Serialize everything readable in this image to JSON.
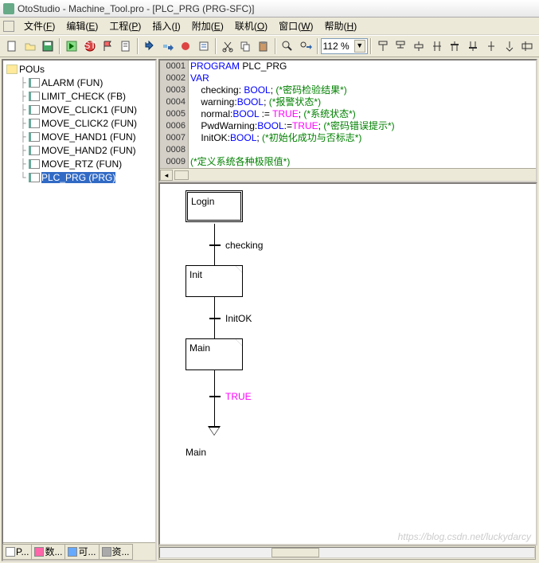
{
  "title": "OtoStudio - Machine_Tool.pro - [PLC_PRG (PRG-SFC)]",
  "menu": {
    "file": "文件",
    "file_k": "F",
    "edit": "编辑",
    "edit_k": "E",
    "project": "工程",
    "project_k": "P",
    "insert": "插入",
    "insert_k": "I",
    "extras": "附加",
    "extras_k": "E",
    "online": "联机",
    "online_k": "O",
    "window": "窗口",
    "window_k": "W",
    "help": "帮助",
    "help_k": "H"
  },
  "toolbar": {
    "zoom": "112 %"
  },
  "tree": {
    "root": "POUs",
    "items": [
      {
        "label": "ALARM (FUN)",
        "selected": false
      },
      {
        "label": "LIMIT_CHECK (FB)",
        "selected": false
      },
      {
        "label": "MOVE_CLICK1 (FUN)",
        "selected": false
      },
      {
        "label": "MOVE_CLICK2 (FUN)",
        "selected": false
      },
      {
        "label": "MOVE_HAND1 (FUN)",
        "selected": false
      },
      {
        "label": "MOVE_HAND2 (FUN)",
        "selected": false
      },
      {
        "label": "MOVE_RTZ (FUN)",
        "selected": false
      },
      {
        "label": "PLC_PRG (PRG)",
        "selected": true
      }
    ]
  },
  "sidebar_tabs": [
    "P...",
    "数...",
    "可...",
    "资..."
  ],
  "code": {
    "lines": [
      {
        "n": "0001",
        "html": "<span class='kw'>PROGRAM</span> PLC_PRG"
      },
      {
        "n": "0002",
        "html": "<span class='kw'>VAR</span>"
      },
      {
        "n": "0003",
        "html": "    checking: <span class='kw'>BOOL</span>; <span class='cm'>(*密码检验结果*)</span>"
      },
      {
        "n": "0004",
        "html": "    warning:<span class='kw'>BOOL</span>; <span class='cm'>(*报警状态*)</span>"
      },
      {
        "n": "0005",
        "html": "    normal:<span class='kw'>BOOL</span> := <span class='hl'>TRUE</span>; <span class='cm'>(*系统状态*)</span>"
      },
      {
        "n": "0006",
        "html": "    PwdWarning:<span class='kw'>BOOL</span>:=<span class='hl'>TRUE</span>; <span class='cm'>(*密码错误提示*)</span>"
      },
      {
        "n": "0007",
        "html": "    InitOK:<span class='kw'>BOOL</span>; <span class='cm'>(*初始化成功与否标志*)</span>"
      },
      {
        "n": "0008",
        "html": ""
      },
      {
        "n": "0009",
        "html": "<span class='cm'>(*定义系统各种极限值*)</span>"
      }
    ]
  },
  "sfc": {
    "steps": [
      {
        "name": "Login",
        "initial": true
      },
      {
        "name": "Init",
        "initial": false
      },
      {
        "name": "Main",
        "initial": false
      }
    ],
    "transitions": [
      "checking",
      "InitOK",
      "TRUE"
    ],
    "final": "Main"
  },
  "watermark": "https://blog.csdn.net/luckydarcy"
}
